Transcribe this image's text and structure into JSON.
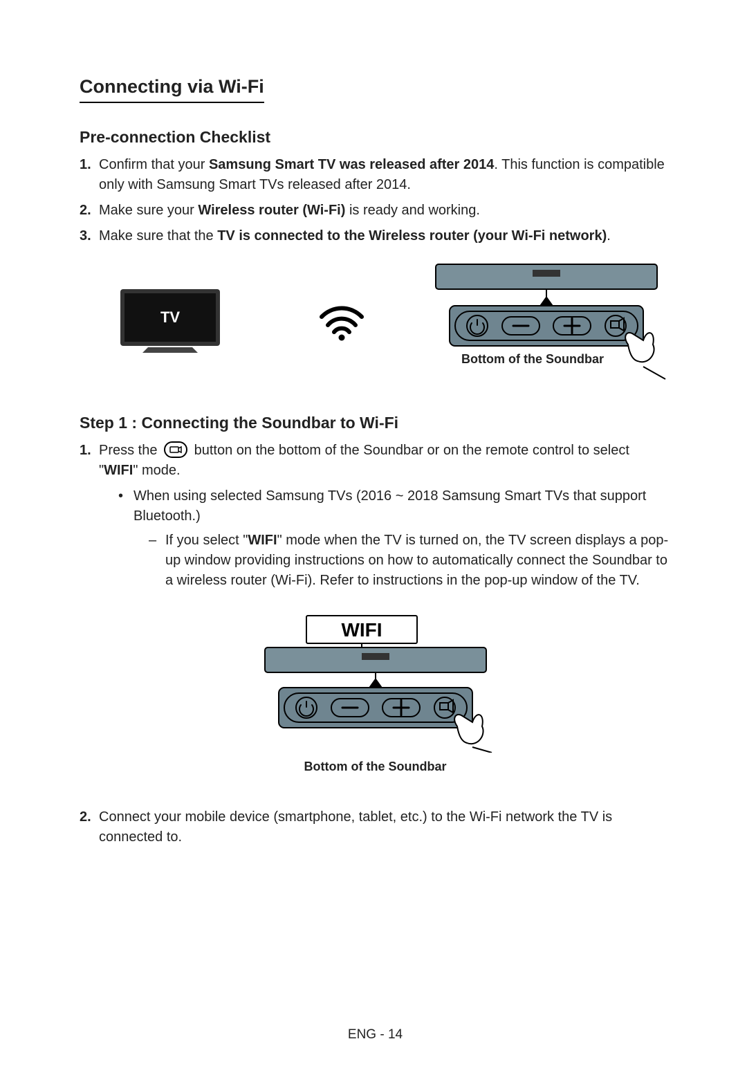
{
  "heading": "Connecting via Wi-Fi",
  "checklist": {
    "title": "Pre-connection Checklist",
    "items": [
      {
        "num": "1.",
        "prefix": "Confirm that your ",
        "bold": "Samsung Smart TV was released after 2014",
        "suffix": ". This function is compatible only with Samsung Smart TVs released after 2014."
      },
      {
        "num": "2.",
        "prefix": "Make sure your ",
        "bold": "Wireless router (Wi-Fi)",
        "suffix": " is ready and working."
      },
      {
        "num": "3.",
        "prefix": "Make sure that the ",
        "bold": "TV is connected to the Wireless router (your Wi-Fi network)",
        "suffix": "."
      }
    ]
  },
  "figure1": {
    "tv_label": "TV",
    "caption": "Bottom of the Soundbar"
  },
  "step1": {
    "title": "Step 1 : Connecting the Soundbar to Wi-Fi",
    "items": [
      {
        "num": "1.",
        "p1a": "Press the ",
        "p1b": " button on the bottom of the Soundbar or on the remote control to select \"",
        "p1bold": "WIFI",
        "p1c": "\" mode.",
        "bullet": "When using selected Samsung TVs (2016 ~ 2018 Samsung Smart TVs that support Bluetooth.)",
        "dash_a": "If you select \"",
        "dash_bold": "WIFI",
        "dash_b": "\" mode when the TV is turned on, the TV screen displays a pop-up window providing instructions on how to automatically connect the Soundbar to a wireless router (Wi-Fi). Refer to instructions in the pop-up window of the TV."
      },
      {
        "num": "2.",
        "text": "Connect your mobile device (smartphone, tablet, etc.) to the Wi-Fi network the TV is connected to."
      }
    ]
  },
  "figure2": {
    "display": "WIFI",
    "caption": "Bottom of the Soundbar"
  },
  "footer": "ENG - 14"
}
